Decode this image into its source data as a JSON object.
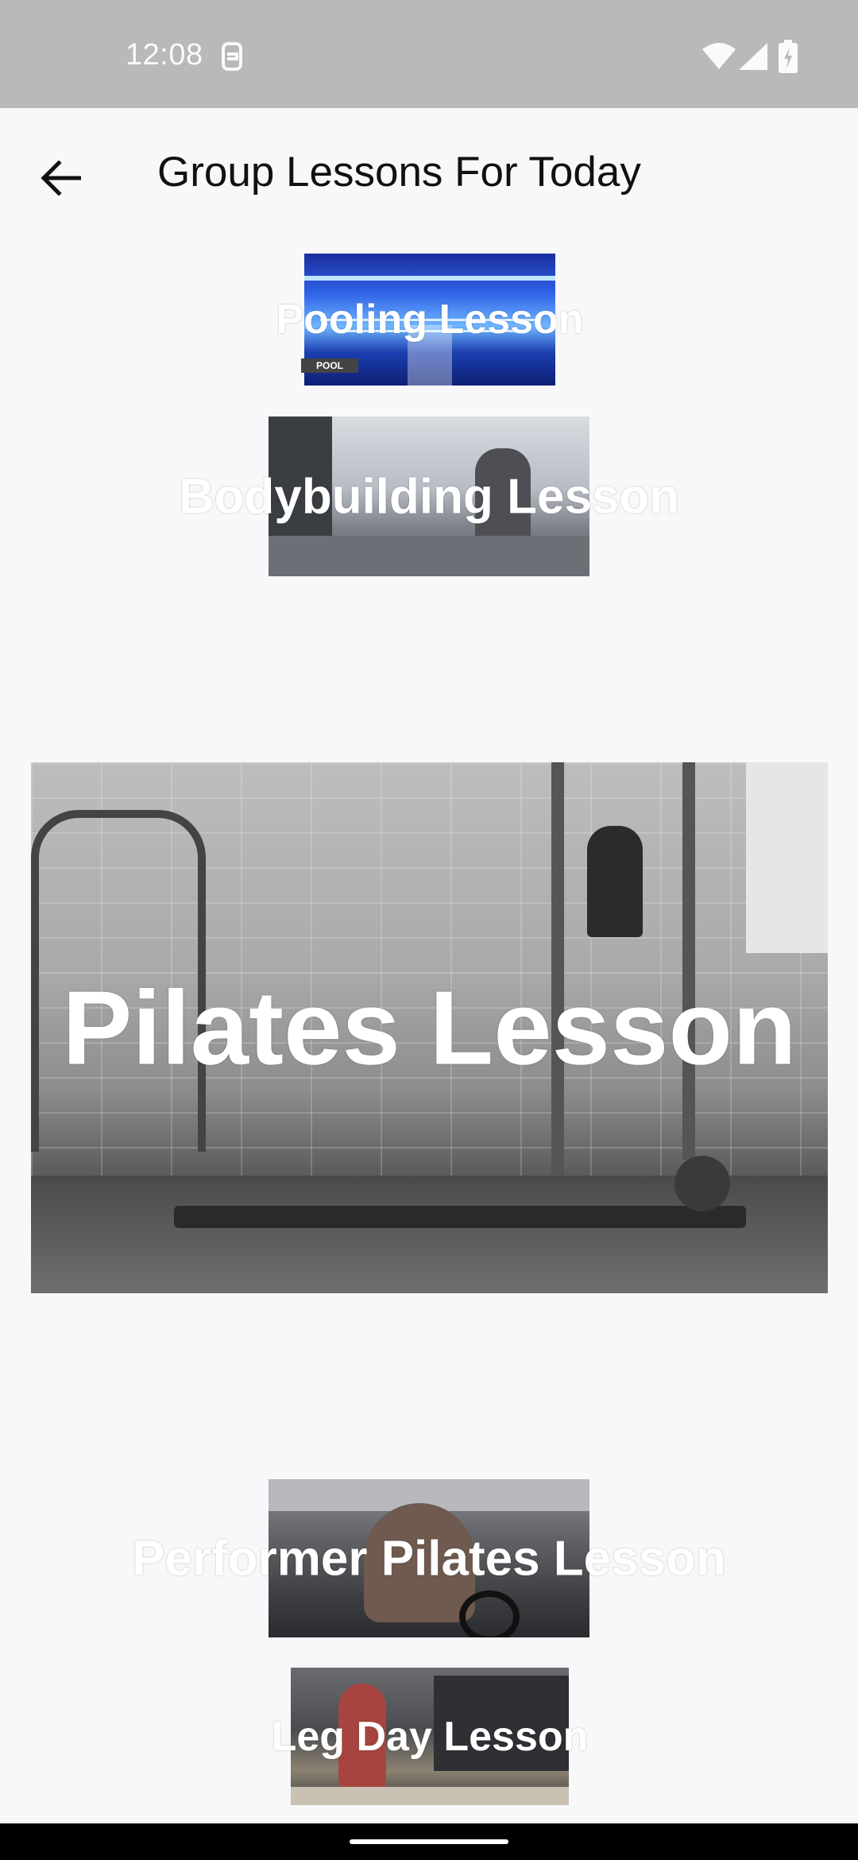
{
  "status_bar": {
    "time": "12:08"
  },
  "header": {
    "title": "Group Lessons For Today"
  },
  "lessons": [
    {
      "label": "Pooling Lesson",
      "badge": "POOL"
    },
    {
      "label": "Bodybuilding Lesson"
    },
    {
      "label": "Pilates Lesson"
    },
    {
      "label": "Performer Pilates Lesson"
    },
    {
      "label": "Leg Day Lesson"
    }
  ],
  "icons": {
    "back": "arrow-left-icon",
    "notification": "screen-record-icon",
    "wifi": "wifi-icon",
    "signal": "cell-signal-icon",
    "battery": "battery-charging-icon"
  },
  "colors": {
    "status_bar": "#b9b9b9",
    "background": "#f8f8fa",
    "lesson_label": "#ffffff",
    "nav_bar": "#000000"
  }
}
